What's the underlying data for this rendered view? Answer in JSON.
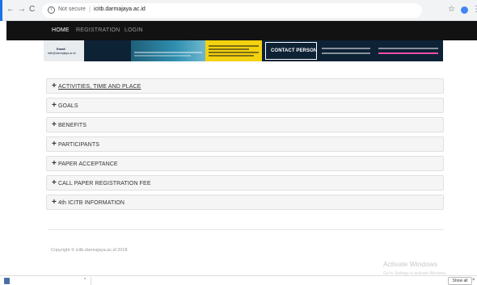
{
  "browser": {
    "back_icon": "←",
    "forward_icon": "→",
    "reload_icon": "C",
    "not_secure": "Not secure",
    "url": "icitb.darmajaya.ac.id",
    "star_icon": "☆",
    "menu_icon": "⋮"
  },
  "nav": {
    "items": [
      {
        "label": "HOME",
        "active": true
      },
      {
        "label": "REGISTRATION",
        "active": false
      },
      {
        "label": "LOGIN",
        "active": false
      }
    ]
  },
  "banner": {
    "email_label": "Email",
    "email": "icitb@darmajaya.ac.id",
    "contact_label": "CONTACT PERSON"
  },
  "accordion": {
    "items": [
      {
        "label": "ACTIVITIES, TIME AND PLACE"
      },
      {
        "label": "GOALS"
      },
      {
        "label": "BENEFITS"
      },
      {
        "label": "PARTICIPANTS"
      },
      {
        "label": "PAPER ACCEPTANCE"
      },
      {
        "label": "CALL PAPER REGISTRATION FEE"
      },
      {
        "label": "4th ICITB INFORMATION"
      }
    ],
    "plus_symbol": "+"
  },
  "footer": {
    "copyright": "Copyright © icitb.darmajaya.ac.id 2018"
  },
  "watermark": {
    "title": "Activate Windows",
    "subtitle": "Go to Settings to activate Windows."
  },
  "download_bar": {
    "show_all": "Show all",
    "close_icon": "×",
    "caret": "^"
  },
  "colors": {
    "nav_bg": "#121212",
    "banner_bg": "#0e2236",
    "banner_yellow": "#f4d20f",
    "accordion_bg": "#f5f5f5"
  }
}
